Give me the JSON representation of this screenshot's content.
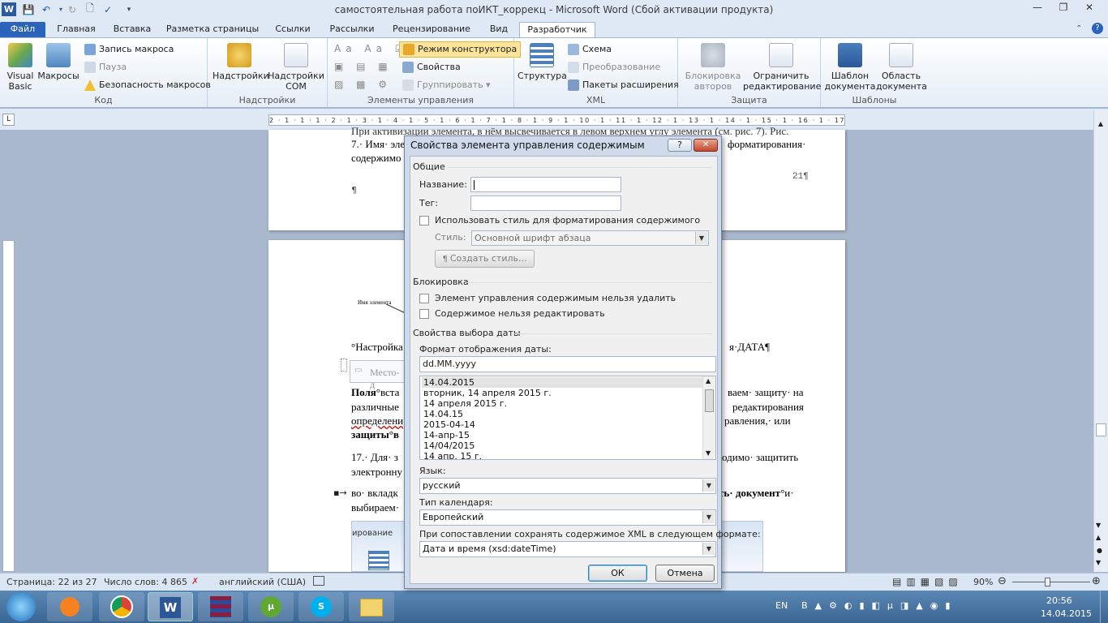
{
  "window": {
    "title": "самостоятельная работа поИКТ_коррекц  -  Microsoft Word (Сбой активации продукта)"
  },
  "tabs": [
    "Файл",
    "Главная",
    "Вставка",
    "Разметка страницы",
    "Ссылки",
    "Рассылки",
    "Рецензирование",
    "Вид",
    "Разработчик"
  ],
  "ribbon": {
    "code": {
      "label": "Код",
      "vb": "Visual Basic",
      "macros": "Макросы",
      "record": "Запись макроса",
      "pause": "Пауза",
      "security": "Безопасность макросов"
    },
    "addins": {
      "label": "Надстройки",
      "addins": "Надстройки",
      "com": "Надстройки COM"
    },
    "controls": {
      "label": "Элементы управления",
      "design": "Режим конструктора",
      "props": "Свойства",
      "group": "Группировать"
    },
    "xml": {
      "label": "XML",
      "structure": "Структура",
      "schema": "Схема",
      "transform": "Преобразование",
      "packs": "Пакеты расширения"
    },
    "protect": {
      "label": "Защита",
      "block": "Блокировка авторов",
      "restrict": "Ограничить редактирование"
    },
    "templates": {
      "label": "Шаблоны",
      "template": "Шаблон документа",
      "panel": "Область документа"
    }
  },
  "ruler": {
    "ticks": "2 · 1 · 1 · 1 · 2 · 1 · 3 · 1 · 4 · 1 · 5 · 1 · 6 · 1 · 7 · 1 · 8 · 1 · 9 · 1 · 10 · 1 · 11 · 1 · 12 · 1 · 13 · 1 · 14 · 1 · 15 · 1 · 16 · 1 · 17 · 1"
  },
  "doc": {
    "p1_line0": "При активизации элемента, в нём высвечивается в левом верхнем углу элемента (см. рис. 7). Рис.",
    "p1_line1a": "7.·  Имя·  эле",
    "p1_line1b": "форматирования·",
    "p1_line2": "содержимо",
    "pagenum": "21¶",
    "pilcrow": "¶",
    "fig_label": "Имя элемента",
    "settings_a": "°Настройка",
    "settings_b": "я·ДАТА¶",
    "placeholder": "Место-д",
    "pole_a": "Поля",
    "pole_a2": "°вста",
    "pole_b": "ваем· защиту· на",
    "l2a": "различные",
    "l2b": "редактирования",
    "l3a": "определени",
    "l3b": "равления,·    или",
    "l4a": "защиты",
    "l4a2": "°в",
    "n17a": "17.·  Для·  з",
    "n17b": "одимо·  защитить",
    "n17c": "электронну",
    "bul_a": "во· вкладк",
    "bul_b": "ть· документ",
    "bul_b2": "°и·",
    "bul_c": "выбираем·",
    "img_tab": "ирование"
  },
  "status": {
    "page": "Страница: 22 из 27",
    "words": "Число слов: 4 865",
    "lang": "английский (США)",
    "zoom": "90%"
  },
  "dialog": {
    "title": "Свойства элемента управления содержимым",
    "help": "?",
    "close": "✕",
    "general": "Общие",
    "name_label": "Название:",
    "tag_label": "Тег:",
    "use_style": "Использовать стиль для форматирования содержимого",
    "style_label": "Стиль:",
    "style_value": "Основной шрифт абзаца",
    "new_style": "Создать стиль...",
    "locking": "Блокировка",
    "lock_delete": "Элемент управления содержимым нельзя удалить",
    "lock_edit": "Содержимое нельзя редактировать",
    "date_props": "Свойства выбора даты",
    "format_label": "Формат отображения даты:",
    "format_value": "dd.MM.yyyy",
    "formats": [
      "14.04.2015",
      "вторник, 14 апреля 2015 г.",
      "14 апреля 2015 г.",
      "14.04.15",
      "2015-04-14",
      "14-апр-15",
      "14/04/2015",
      "14 апр. 15 г."
    ],
    "lang_label": "Язык:",
    "lang_value": "русский",
    "cal_label": "Тип календаря:",
    "cal_value": "Европейский",
    "xml_label": "При сопоставлении сохранять содержимое XML в следующем формате:",
    "xml_value": "Дата и время (xsd:dateTime)",
    "ok": "ОК",
    "cancel": "Отмена"
  },
  "tray": {
    "lang": "EN",
    "time": "20:56",
    "date": "14.04.2015"
  }
}
